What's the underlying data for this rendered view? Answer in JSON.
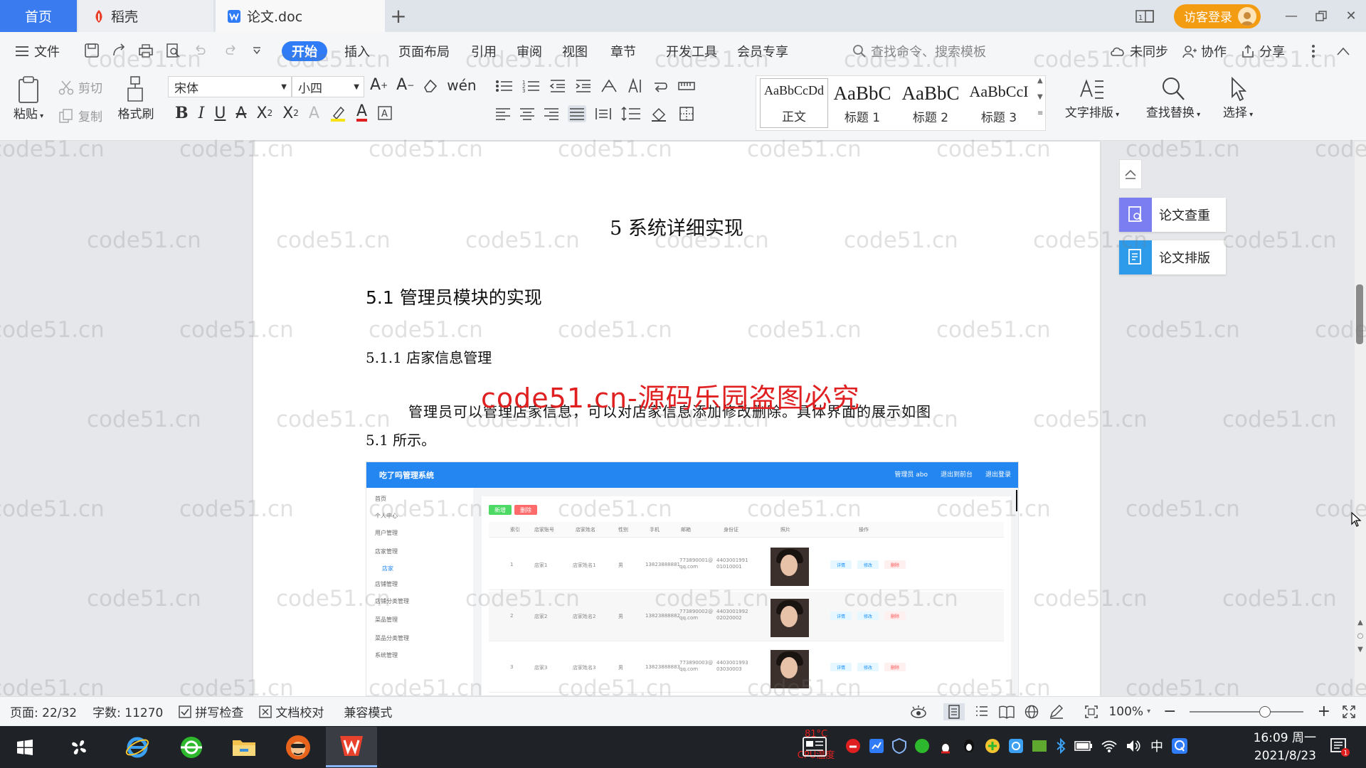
{
  "tabs": {
    "home": "首页",
    "docer": "稻壳",
    "doc": "论文.doc"
  },
  "titlebar": {
    "login": "访客登录"
  },
  "menu": {
    "file": "文件",
    "items": [
      "开始",
      "插入",
      "页面布局",
      "引用",
      "审阅",
      "视图",
      "章节",
      "开发工具",
      "会员专享"
    ],
    "search": "查找命令、搜索模板",
    "sync": "未同步",
    "collab": "协作",
    "share": "分享"
  },
  "ribbon": {
    "paste": "粘贴",
    "cut": "剪切",
    "copy": "复制",
    "format_painter": "格式刷",
    "font_name": "宋体",
    "font_size": "小四",
    "styles": [
      {
        "sample": "AaBbCcDd",
        "name": "正文"
      },
      {
        "sample": "AaBbC",
        "name": "标题 1"
      },
      {
        "sample": "AaBbC",
        "name": "标题 2"
      },
      {
        "sample": "AaBbCcI",
        "name": "标题 3"
      }
    ],
    "text_layout": "文字排版",
    "find_replace": "查找替换",
    "select": "选择"
  },
  "document": {
    "chapter_title": "5 系统详细实现",
    "section_title": "5.1  管理员模块的实现",
    "subsection_title": "5.1.1  店家信息管理",
    "para_line1": "管理员可以管理店家信息，可以对店家信息添加修改删除。具体界面的展示如图",
    "para_line2": "5.1 所示。",
    "red_watermark": "code51.cn-源码乐园盗图必究",
    "watermark": "code51.cn"
  },
  "figure": {
    "app_title": "吃了吗管理系统",
    "top_links": [
      "管理员 abo",
      "退出到前台",
      "退出登录"
    ],
    "side_items": [
      "首页",
      "个人中心",
      "用户管理",
      "店家管理",
      "店家",
      "店铺管理",
      "店铺分类管理",
      "菜品管理",
      "菜品分类管理",
      "系统管理"
    ],
    "buttons": [
      "新增",
      "删除"
    ],
    "headers": [
      "索引",
      "店家账号",
      "店家姓名",
      "性别",
      "手机",
      "邮箱",
      "身份证",
      "照片",
      "操作"
    ],
    "rows": [
      {
        "idx": "1",
        "account": "店家1",
        "name": "店家姓名1",
        "sex": "男",
        "phone": "13823888881",
        "email": "773890001@qq.com",
        "idcard": "440300199101010001"
      },
      {
        "idx": "2",
        "account": "店家2",
        "name": "店家姓名2",
        "sex": "男",
        "phone": "13823888882",
        "email": "773890002@qq.com",
        "idcard": "440300199202020002"
      },
      {
        "idx": "3",
        "account": "店家3",
        "name": "店家姓名3",
        "sex": "男",
        "phone": "13823888883",
        "email": "773890003@qq.com",
        "idcard": "440300199303030003"
      }
    ],
    "ops": [
      "详情",
      "修改",
      "删除"
    ]
  },
  "side_panel": {
    "check": "论文查重",
    "layout": "论文排版"
  },
  "status": {
    "page": "页面: 22/32",
    "words": "字数: 11270",
    "spell": "拼写检查",
    "proof": "文档校对",
    "compat": "兼容模式",
    "zoom": "100%"
  },
  "taskbar": {
    "time": "16:09 周一",
    "date": "2021/8/23",
    "cpu_label": "CPU温度",
    "cpu_value": "81°C",
    "ime": "中"
  },
  "colors": {
    "accent": "#2f7cf6",
    "login": "#f39c12",
    "red_watermark": "#e02020"
  }
}
